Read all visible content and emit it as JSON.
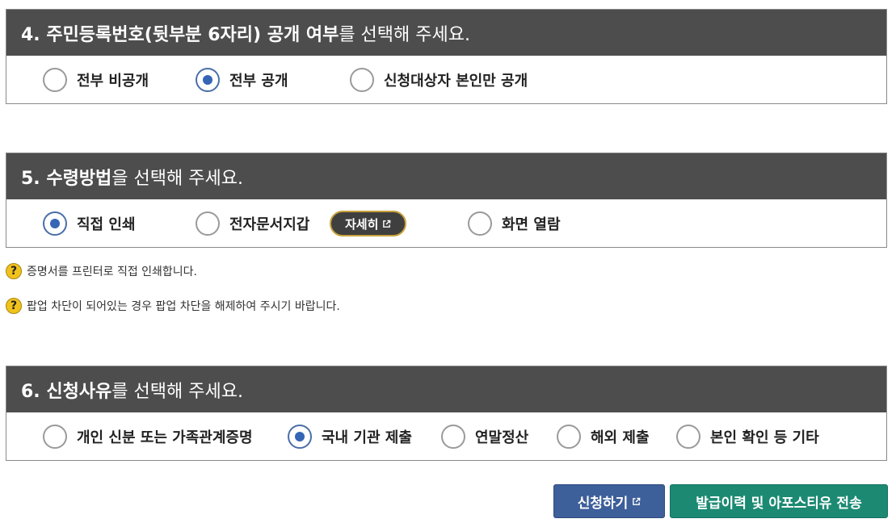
{
  "section4": {
    "title_bold": "4. 주민등록번호(뒷부분 6자리) 공개 여부",
    "title_rest": "를 선택해 주세요.",
    "options": [
      {
        "label": "전부 비공개",
        "checked": false
      },
      {
        "label": "전부 공개",
        "checked": true
      },
      {
        "label": "신청대상자 본인만 공개",
        "checked": false
      }
    ]
  },
  "section5": {
    "title_bold": "5. 수령방법",
    "title_rest": "을 선택해 주세요.",
    "options": [
      {
        "label": "직접 인쇄",
        "checked": true
      },
      {
        "label": "전자문서지갑",
        "checked": false
      },
      {
        "label": "화면 열람",
        "checked": false
      }
    ],
    "detail_button": "자세히",
    "notes": [
      "증명서를 프린터로 직접 인쇄합니다.",
      "팝업 차단이 되어있는 경우 팝업 차단을 해제하여 주시기 바랍니다."
    ],
    "note_icon": "?"
  },
  "section6": {
    "title_bold": "6. 신청사유",
    "title_rest": "를 선택해 주세요.",
    "options": [
      {
        "label": "개인 신분 또는 가족관계증명",
        "checked": false
      },
      {
        "label": "국내 기관 제출",
        "checked": true
      },
      {
        "label": "연말정산",
        "checked": false
      },
      {
        "label": "해외 제출",
        "checked": false
      },
      {
        "label": "본인 확인 등 기타",
        "checked": false
      }
    ]
  },
  "buttons": {
    "apply": "신청하기",
    "send": "발급이력 및 아포스티유 전송"
  },
  "colors": {
    "header_bg": "#4d4d4d",
    "radio_checked": "#3565b5",
    "apply_button": "#3d5f9a",
    "send_button": "#1c8a73",
    "help_icon": "#f2c21c"
  },
  "icons": {
    "external_link": "external-link-icon",
    "help": "question-icon"
  }
}
